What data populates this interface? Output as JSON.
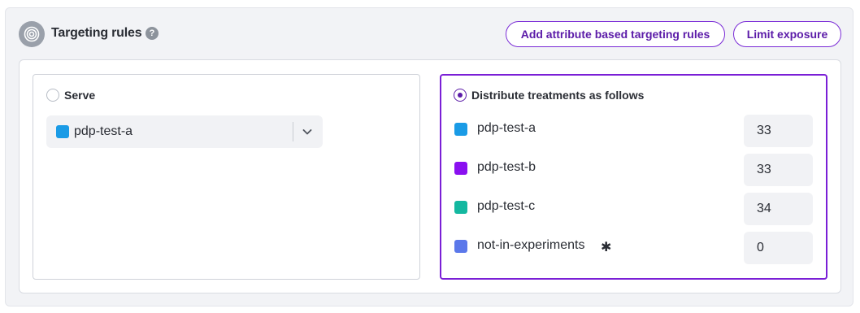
{
  "header": {
    "title": "Targeting rules",
    "help": "?",
    "add_rules_label": "Add attribute based targeting rules",
    "limit_label": "Limit exposure"
  },
  "serve": {
    "label": "Serve",
    "selected": {
      "name": "pdp-test-a",
      "color": "#1a9be6"
    }
  },
  "distribute": {
    "label": "Distribute treatments as follows",
    "treatments": [
      {
        "name": "pdp-test-a",
        "color": "#1a9be6",
        "value": "33"
      },
      {
        "name": "pdp-test-b",
        "color": "#8a10f0",
        "value": "33"
      },
      {
        "name": "pdp-test-c",
        "color": "#14b8a0",
        "value": "34"
      },
      {
        "name": "not-in-experiments",
        "color": "#5b78ea",
        "value": "0",
        "marker": "✱"
      }
    ]
  },
  "colors": {
    "accent": "#5b1ba8",
    "accent_border": "#7a1fd6"
  },
  "icons": [
    "target-icon",
    "help-icon",
    "chevron-down-icon",
    "asterisk-icon"
  ]
}
